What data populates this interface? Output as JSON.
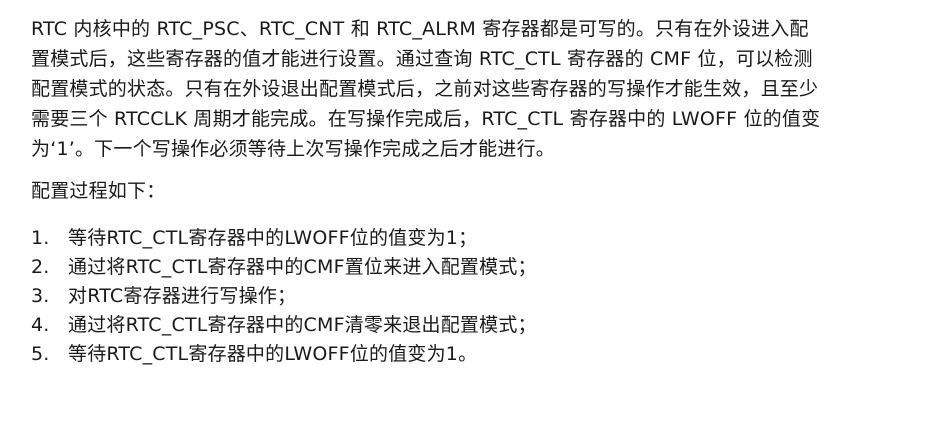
{
  "document": {
    "paragraph_lines": [
      "RTC 内核中的 RTC_PSC、RTC_CNT 和 RTC_ALRM 寄存器都是可写的。只有在外设进入配",
      "置模式后，这些寄存器的值才能进行设置。通过查询 RTC_CTL 寄存器的 CMF 位，可以检测",
      "配置模式的状态。只有在外设退出配置模式后，之前对这些寄存器的写操作才能生效，且至少",
      "需要三个 RTCCLK 周期才能完成。在写操作完成后，RTC_CTL 寄存器中的 LWOFF 位的值变",
      "为‘1’。下一个写操作必须等待上次写操作完成之后才能进行。"
    ],
    "procedure_heading": "配置过程如下：",
    "steps": [
      {
        "num": "1.",
        "text": "等待RTC_CTL寄存器中的LWOFF位的值变为1；"
      },
      {
        "num": "2.",
        "text": "通过将RTC_CTL寄存器中的CMF置位来进入配置模式；"
      },
      {
        "num": "3.",
        "text": "对RTC寄存器进行写操作；"
      },
      {
        "num": "4.",
        "text": "通过将RTC_CTL寄存器中的CMF清零来退出配置模式；"
      },
      {
        "num": "5.",
        "text": "等待RTC_CTL寄存器中的LWOFF位的值变为1。"
      }
    ]
  }
}
